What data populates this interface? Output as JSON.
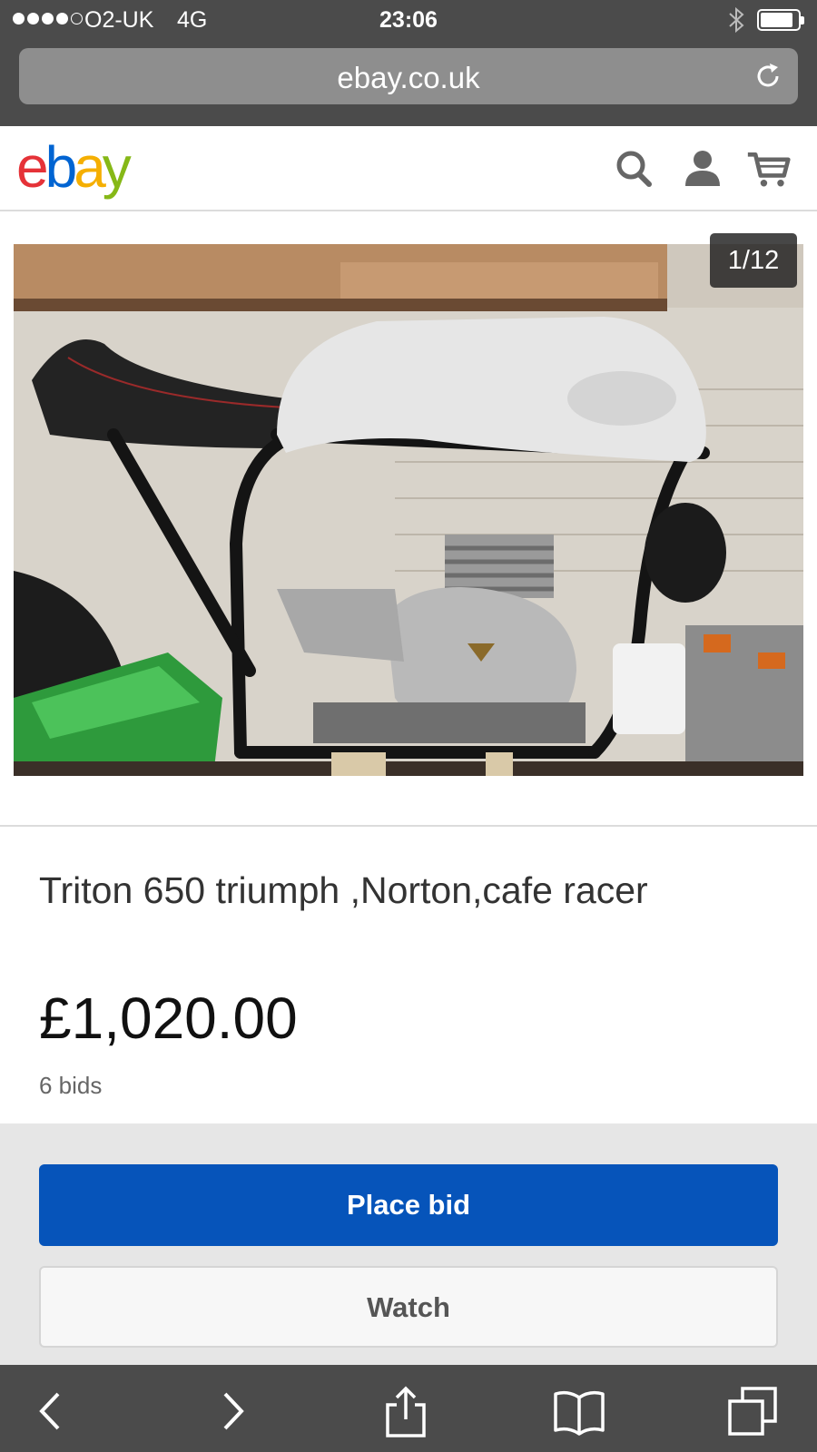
{
  "status_bar": {
    "carrier": "O2-UK",
    "network": "4G",
    "time": "23:06",
    "signal_bars_filled": 4,
    "signal_bars_total": 5,
    "battery_level": 0.88,
    "bluetooth_icon": "bluetooth-icon"
  },
  "browser": {
    "url": "ebay.co.uk",
    "reload_icon": "reload-icon"
  },
  "header": {
    "logo_text": {
      "e": "e",
      "b": "b",
      "a": "a",
      "y": "y"
    },
    "logo_colors": [
      "#e53238",
      "#0064d2",
      "#f5af02",
      "#86b817"
    ],
    "icons": [
      "search-icon",
      "user-icon",
      "cart-icon"
    ]
  },
  "gallery": {
    "counter": "1/12"
  },
  "item": {
    "title": "Triton 650 triumph ,Norton,cafe racer",
    "price": "£1,020.00",
    "bids": "6 bids"
  },
  "actions": {
    "place_bid": "Place bid",
    "watch": "Watch",
    "primary_color": "#0654ba"
  },
  "toolbar": {
    "icons": [
      "back-icon",
      "forward-icon",
      "share-icon",
      "bookmarks-icon",
      "tabs-icon"
    ]
  }
}
